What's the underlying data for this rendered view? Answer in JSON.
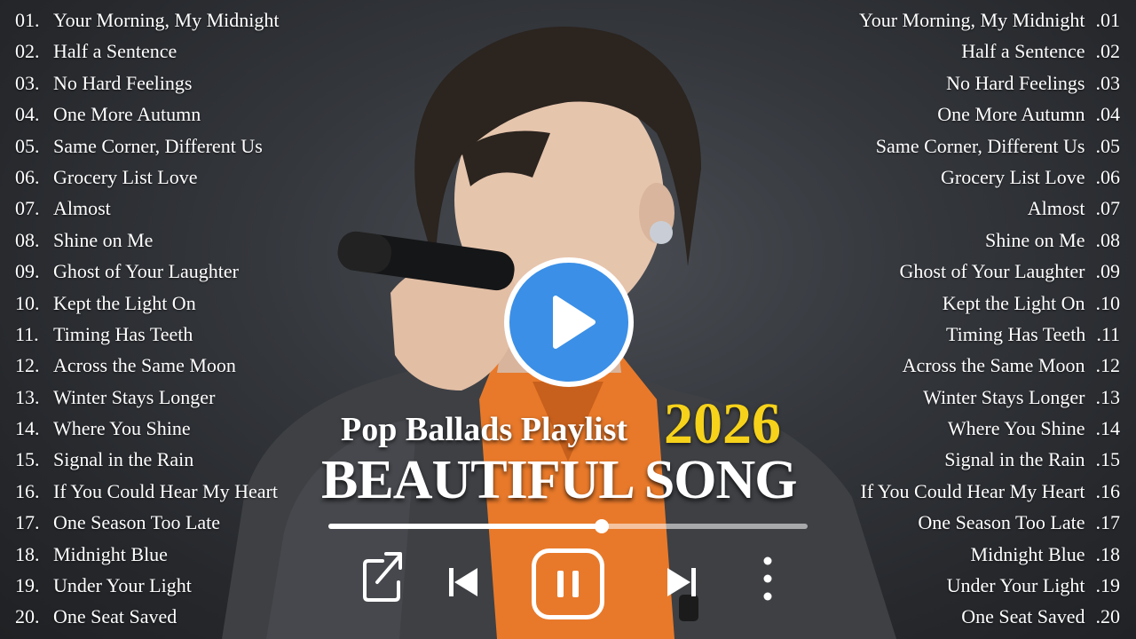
{
  "tracks": [
    {
      "num": "01.",
      "rnum": ".01",
      "title": "Your Morning, My Midnight"
    },
    {
      "num": "02.",
      "rnum": ".02",
      "title": "Half a Sentence"
    },
    {
      "num": "03.",
      "rnum": ".03",
      "title": "No Hard Feelings"
    },
    {
      "num": "04.",
      "rnum": ".04",
      "title": "One More Autumn"
    },
    {
      "num": "05.",
      "rnum": ".05",
      "title": "Same Corner, Different Us"
    },
    {
      "num": "06.",
      "rnum": ".06",
      "title": "Grocery List Love"
    },
    {
      "num": "07.",
      "rnum": ".07",
      "title": "Almost"
    },
    {
      "num": "08.",
      "rnum": ".08",
      "title": "Shine on Me"
    },
    {
      "num": "09.",
      "rnum": ".09",
      "title": "Ghost of Your Laughter"
    },
    {
      "num": "10.",
      "rnum": ".10",
      "title": "Kept the Light On"
    },
    {
      "num": "11.",
      "rnum": ".11",
      "title": "Timing Has Teeth"
    },
    {
      "num": "12.",
      "rnum": ".12",
      "title": "Across the Same Moon"
    },
    {
      "num": "13.",
      "rnum": ".13",
      "title": "Winter Stays Longer"
    },
    {
      "num": "14.",
      "rnum": ".14",
      "title": "Where You Shine"
    },
    {
      "num": "15.",
      "rnum": ".15",
      "title": "Signal in the Rain"
    },
    {
      "num": "16.",
      "rnum": ".16",
      "title": "If You Could Hear My Heart"
    },
    {
      "num": "17.",
      "rnum": ".17",
      "title": "One Season Too Late"
    },
    {
      "num": "18.",
      "rnum": ".18",
      "title": "Midnight Blue"
    },
    {
      "num": "19.",
      "rnum": ".19",
      "title": "Under Your Light"
    },
    {
      "num": "20.",
      "rnum": ".20",
      "title": "One Seat Saved"
    }
  ],
  "title": {
    "subtitle": "Pop Ballads Playlist",
    "year": "2026",
    "headline": "BEAUTIFUL SONG"
  },
  "player": {
    "progress": 0.57,
    "controls": [
      "share-icon",
      "previous-icon",
      "pause-icon",
      "next-icon",
      "more-icon"
    ]
  },
  "colors": {
    "accent_year": "#f6d21a",
    "play_button": "#3b8fe6",
    "jacket": "#3f4145",
    "shirt": "#e8792a"
  }
}
